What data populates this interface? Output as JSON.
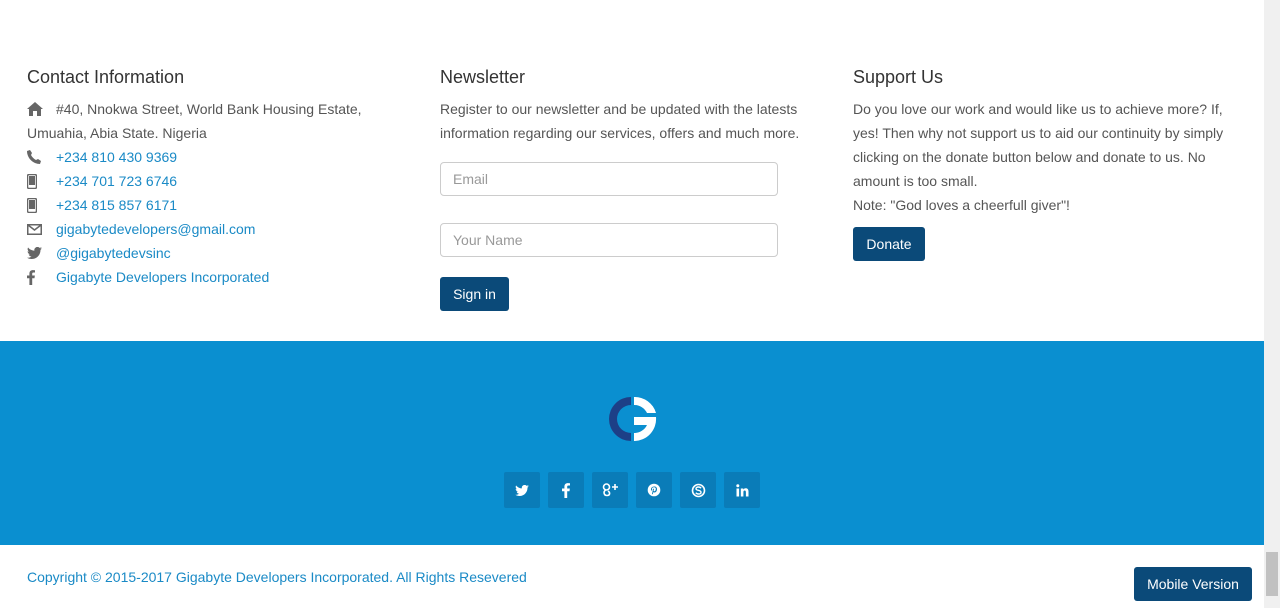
{
  "contact": {
    "heading": "Contact Information",
    "address_line1": "#40, Nnokwa Street, World Bank Housing Estate,",
    "address_line2": "Umuahia, Abia State. Nigeria",
    "phone1": "+234 810 430 9369",
    "phone2": "+234 701 723 6746",
    "phone3": "+234 815 857 6171",
    "email": "gigabytedevelopers@gmail.com",
    "twitter": "@gigabytedevsinc",
    "facebook": "Gigabyte Developers Incorporated"
  },
  "newsletter": {
    "heading": "Newsletter",
    "description": "Register to our newsletter and be updated with the latests information regarding our services, offers and much more.",
    "email_placeholder": "Email",
    "name_placeholder": "Your Name",
    "signin_label": "Sign in"
  },
  "support": {
    "heading": "Support Us",
    "description": "Do you love our work and would like us to achieve more? If, yes! Then why not support us to aid our continuity by simply clicking on the donate button below and donate to us. No amount is too small.",
    "note": "Note: \"God loves a cheerfull giver\"!",
    "donate_label": "Donate"
  },
  "social": {
    "icons": [
      "twitter-icon",
      "facebook-icon",
      "google-plus-icon",
      "pinterest-icon",
      "skype-icon",
      "linkedin-icon"
    ]
  },
  "footer": {
    "copyright": "Copyright © 2015-2017 Gigabyte Developers Incorporated. All Rights Resevered",
    "mobile_version_label": "Mobile Version"
  },
  "colors": {
    "band_blue": "#0a8fd0",
    "button_navy": "#0b4a79",
    "link_blue": "#1a8ac6",
    "logo_navy": "#1d3f87"
  }
}
